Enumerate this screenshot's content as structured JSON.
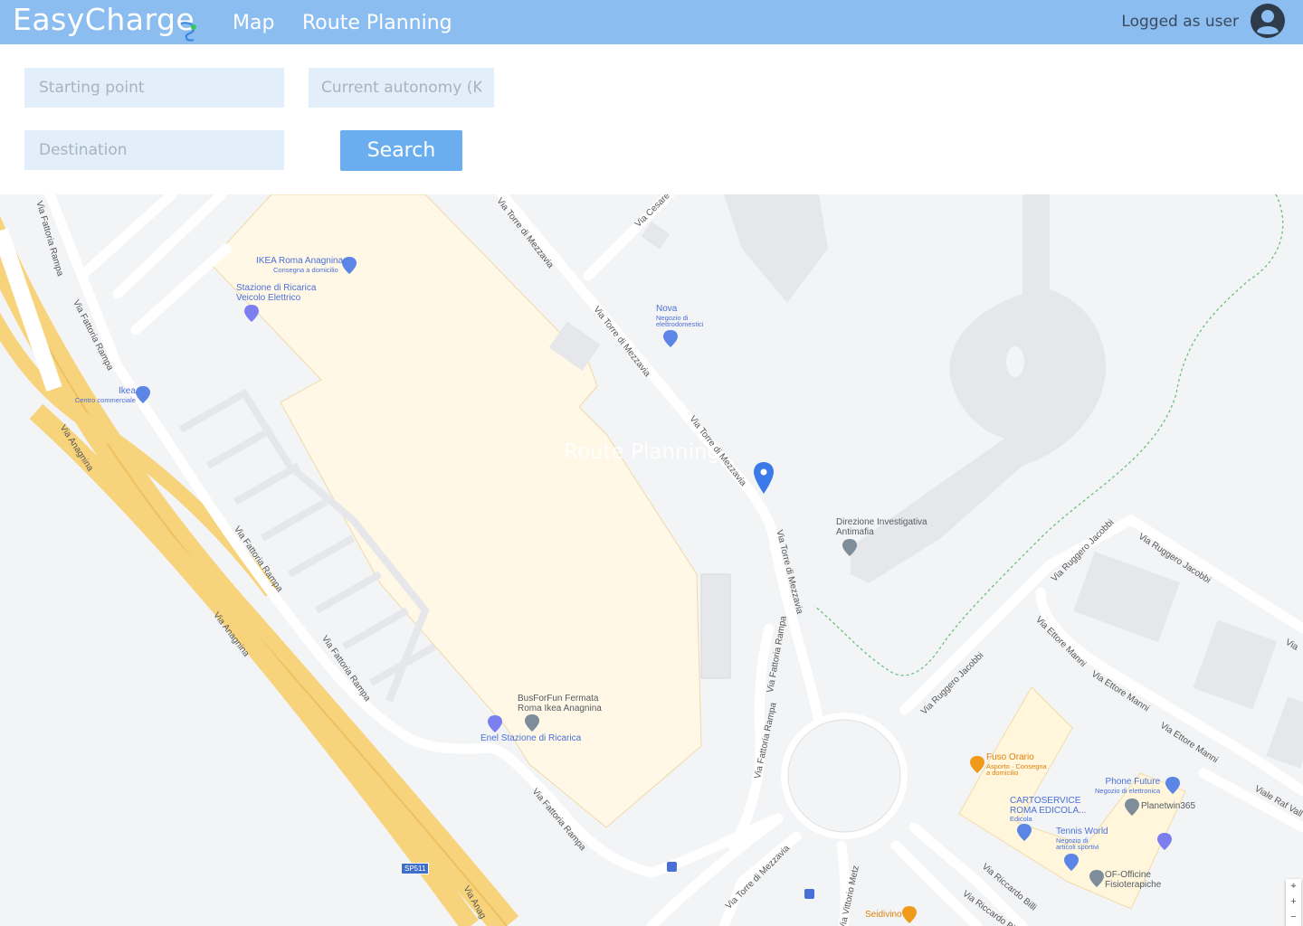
{
  "header": {
    "brand": "EasyCharge",
    "nav": {
      "map": "Map",
      "route_planning": "Route Planning"
    },
    "logged_as": "Logged as user"
  },
  "form": {
    "starting_point_placeholder": "Starting point",
    "autonomy_placeholder": "Current autonomy (Km)",
    "destination_placeholder": "Destination",
    "search_label": "Search"
  },
  "map": {
    "overlay_title": "Route Planning",
    "pois": {
      "ikea_roma": {
        "name": "IKEA Roma Anagnina",
        "sub": "Consegna a domicilio"
      },
      "stazione_ricarica": {
        "name": "Stazione di Ricarica",
        "sub": "Veicolo Elettrico"
      },
      "nova": {
        "name": "Nova",
        "sub1": "Negozio di",
        "sub2": "elettrodomestici"
      },
      "ikea": {
        "name": "Ikea",
        "sub": "Centro commerciale"
      },
      "direzione": {
        "name": "Direzione Investigativa",
        "name2": "Antimafia"
      },
      "busforfun": {
        "name": "BusForFun Fermata",
        "name2": "Roma Ikea Anagnina"
      },
      "enel": {
        "name": "Enel Stazione di Ricarica"
      },
      "fuso_orario": {
        "name": "Fuso Orario",
        "sub1": "Asporto · Consegna",
        "sub2": "a domicilio"
      },
      "phone_future": {
        "name": "Phone Future",
        "sub": "Negozio di elettronica"
      },
      "planetwin": {
        "name": "Planetwin365"
      },
      "cartoservice": {
        "name": "CARTOSERVICE",
        "name2": "ROMA EDICOLA...",
        "sub": "Edicola"
      },
      "tennis_world": {
        "name": "Tennis World",
        "sub1": "Negozio di",
        "sub2": "articoli sportivi"
      },
      "of_officine": {
        "name": "OF-Officine",
        "name2": "Fisioterapiche"
      },
      "seidivino": {
        "name": "Seidivino"
      }
    },
    "streets": {
      "fattoria": "Via Fattoria Rampa",
      "torre": "Via Torre di Mezzavia",
      "anagnina": "Via Anagnina",
      "anag_cut": "Via Anag",
      "cesare": "Via Cesare",
      "jacobbi": "Via Ruggero Jacobbi",
      "manni": "Via Ettore Manni",
      "riccardo": "Via Riccardo Billi",
      "riccardo_cut": "Via Riccardo Bill",
      "raf": "Viale Raf Vall",
      "via_cut": "Via",
      "metz": "Via Vittorio Metz"
    },
    "road_badge": "SP511",
    "zoom": {
      "locate": "⌖",
      "in": "+",
      "out": "−"
    }
  },
  "colors": {
    "header_bg": "#8bbdf0",
    "field_bg": "#e2eefa",
    "button_bg": "#6aaef0",
    "marker": "#3b7ae8"
  }
}
